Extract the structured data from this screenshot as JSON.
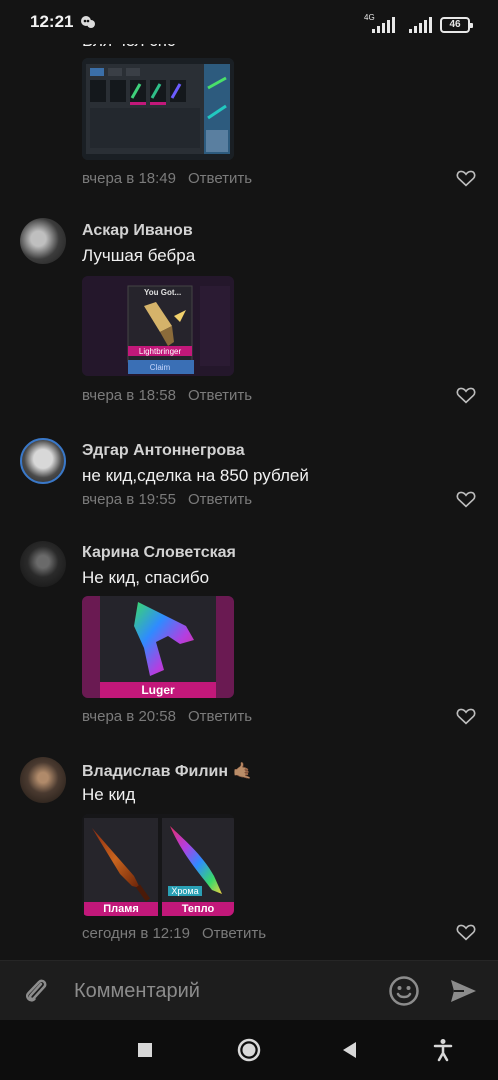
{
  "status_bar": {
    "time": "12:21",
    "network_label": "4G",
    "battery": "46"
  },
  "comments": [
    {
      "author": "",
      "text": "Бля чел спс",
      "time": "вчера в 18:49",
      "reply": "Ответить",
      "attachment": "game-inventory-screenshot"
    },
    {
      "author": "Аскар Иванов",
      "text": "Лучшая бебра",
      "time": "вчера в 18:58",
      "reply": "Ответить",
      "attachment": {
        "header": "You Got...",
        "item": "Lightbringer",
        "action": "Claim"
      }
    },
    {
      "author": "Эдгар Антоннегрова",
      "text": "не кид,сделка на 850 рублей",
      "time": "вчера в 19:55",
      "reply": "Ответить"
    },
    {
      "author": "Карина Словетская",
      "text": "Не кид, спасибо",
      "time": "вчера в 20:58",
      "reply": "Ответить",
      "attachment": {
        "item": "Luger"
      }
    },
    {
      "author": "Владислав Филин",
      "author_emoji": "🤙🏽",
      "text": "Не кид",
      "time": "сегодня в 12:19",
      "reply": "Ответить",
      "attachment": {
        "left_item": "Пламя",
        "right_item": "Тепло",
        "right_tag": "Хрома"
      }
    }
  ],
  "composer": {
    "placeholder": "Комментарий"
  },
  "icons": {
    "attach": "paperclip-icon",
    "emoji": "smile-icon",
    "send": "send-icon",
    "like": "heart-icon",
    "nav_recents": "square-icon",
    "nav_home": "circle-icon",
    "nav_back": "triangle-icon",
    "nav_accessibility": "accessibility-icon"
  },
  "colors": {
    "background": "#141414",
    "meta_text": "#7b7b7b",
    "accent_pink": "#c2187a"
  }
}
